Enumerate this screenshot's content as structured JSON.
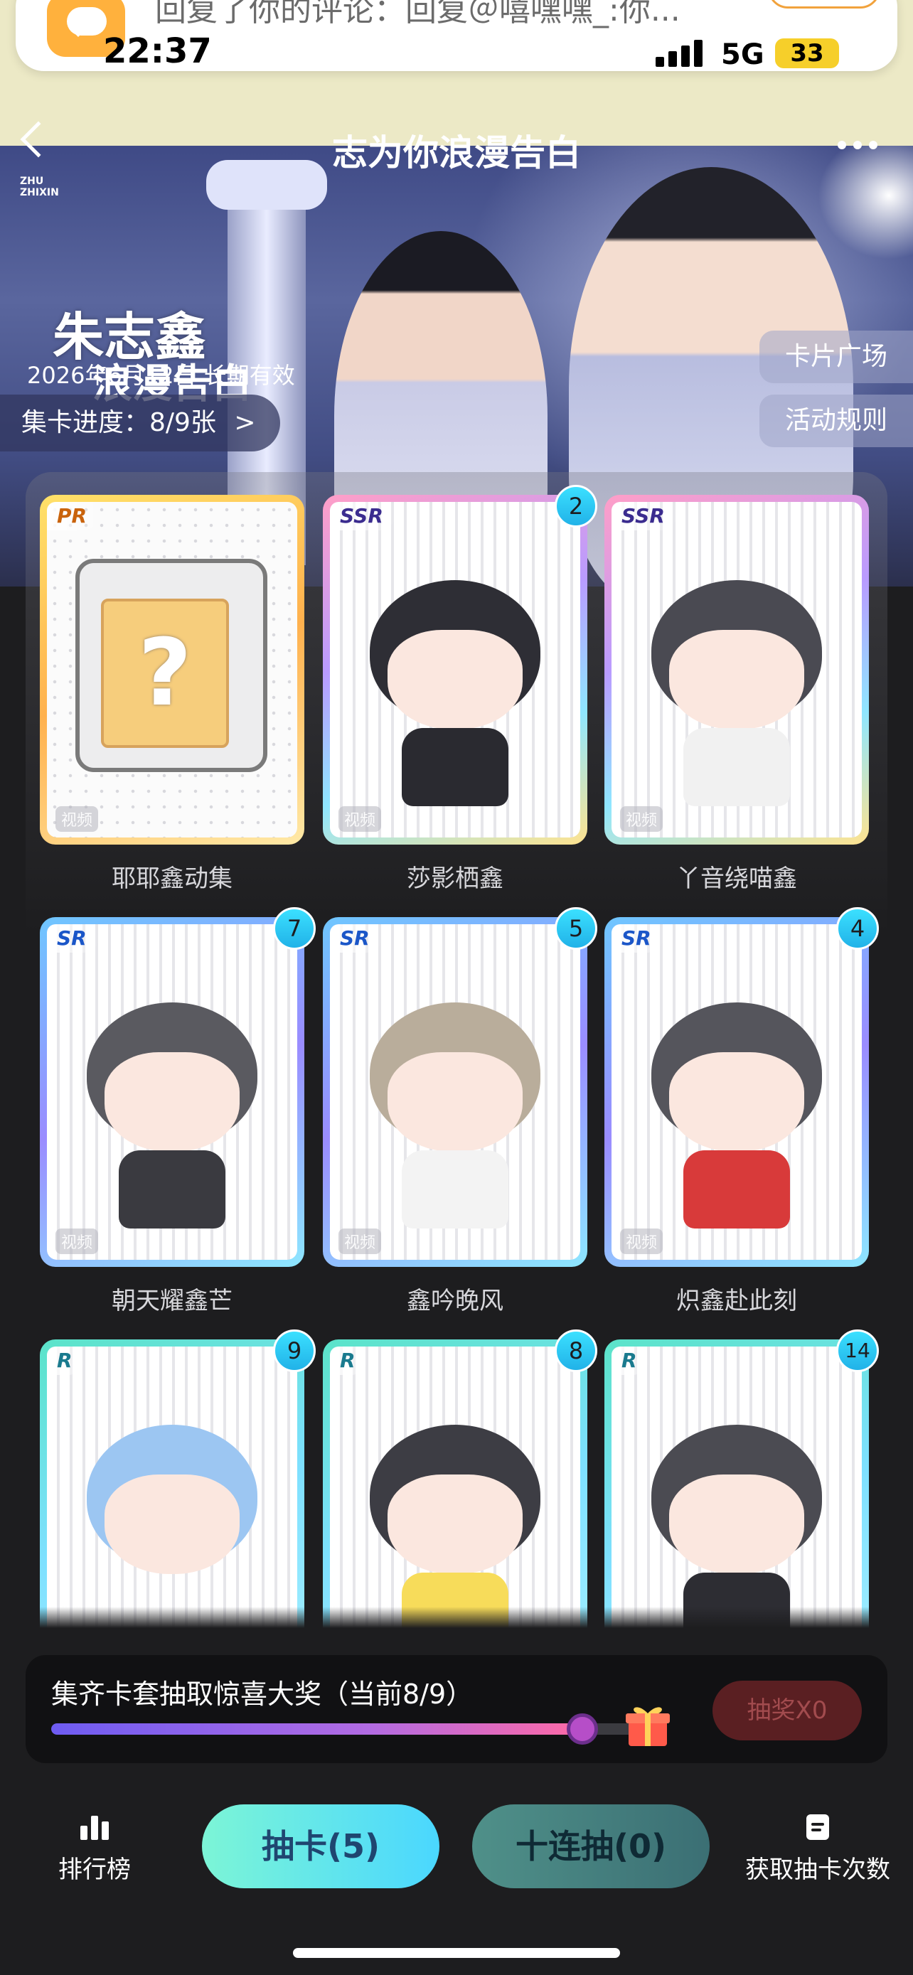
{
  "status_bar": {
    "time": "22:37",
    "network": "5G",
    "battery": "33"
  },
  "notification": {
    "text": "回复了你的评论：回复＠嘻嘿嘿_:你...",
    "reply_label": "回复"
  },
  "header": {
    "title": "志为你浪漫告白"
  },
  "banner": {
    "logo_line1": "ZHU",
    "logo_line2": "ZHIXIN",
    "artist_name": "朱志鑫",
    "artist_subtitle": "浪漫告白",
    "validity": "2026年6月12日 长期有效",
    "progress_label": "集卡进度：8/9张",
    "progress_arrow": ">",
    "side_buttons": [
      "卡片广场",
      "活动规则"
    ]
  },
  "cards": [
    {
      "rarity": "PR",
      "name": "耶耶鑫动集",
      "count": "",
      "stamp": "视频",
      "mystery": "?"
    },
    {
      "rarity": "SSR",
      "name": "莎影栖鑫",
      "count": "2",
      "stamp": "视频"
    },
    {
      "rarity": "SSR",
      "name": "丫音绕喵鑫",
      "count": "",
      "stamp": "视频"
    },
    {
      "rarity": "SR",
      "name": "朝天耀鑫芒",
      "count": "7",
      "stamp": "视频"
    },
    {
      "rarity": "SR",
      "name": "鑫吟晚风",
      "count": "5",
      "stamp": "视频"
    },
    {
      "rarity": "SR",
      "name": "炽鑫赴此刻",
      "count": "4",
      "stamp": "视频"
    },
    {
      "rarity": "R",
      "name": "",
      "count": "9",
      "stamp": ""
    },
    {
      "rarity": "R",
      "name": "",
      "count": "8",
      "stamp": ""
    },
    {
      "rarity": "R",
      "name": "",
      "count": "14",
      "stamp": ""
    }
  ],
  "reward": {
    "title": "集齐卡套抽取惊喜大奖（当前8/9）",
    "progress": 0.889,
    "lottery_label": "抽奖X0"
  },
  "tab_bar": {
    "ranking_label": "排行榜",
    "draw_label": "抽卡(5)",
    "ten_draw_label": "十连抽(0)",
    "get_draws_label": "获取抽卡次数"
  },
  "colors": {
    "accent_cyan": "#4ad7ff",
    "reward_gradient_start": "#6e5cf2",
    "reward_gradient_end": "#ff6aa6",
    "lottery_disabled": "#5a1f22"
  },
  "icons": [
    "chat-app-icon",
    "back-icon",
    "more-icon",
    "chevron-right-icon",
    "gift-icon",
    "ranking-icon",
    "document-icon",
    "signal-icon",
    "battery-icon"
  ]
}
